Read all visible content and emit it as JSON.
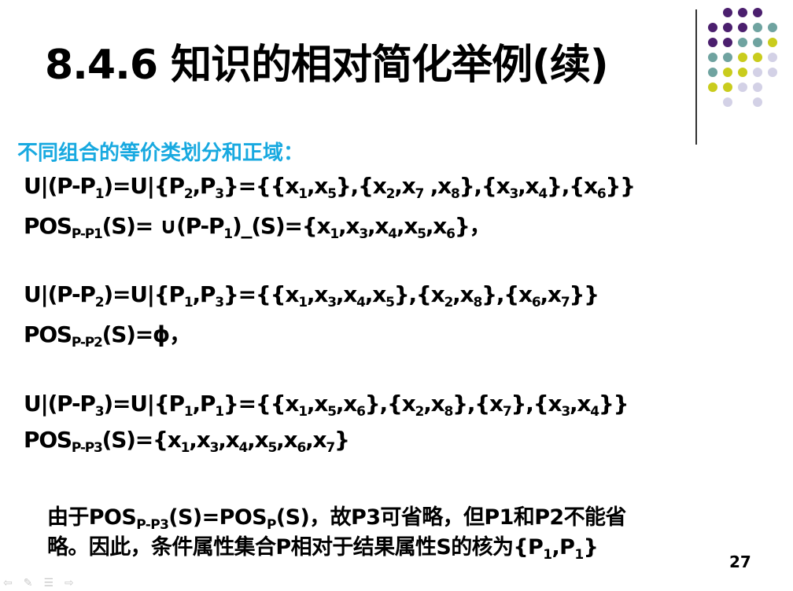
{
  "title": "8.4.6 知识的相对简化举例(续)",
  "subtitle": "不同组合的等价类划分和正域：",
  "equations": {
    "u1": [
      "U|(P-P",
      "1",
      ")=U|{P",
      "2",
      ",P",
      "3",
      "}={{x",
      "1",
      ",x",
      "5",
      "},{x",
      "2",
      ",x",
      "7",
      " ,x",
      "8",
      "},{x",
      "3",
      ",x",
      "4",
      "},{x",
      "6",
      "}}"
    ],
    "pos1": [
      "POS",
      "P-P1",
      "(S)= ∪(P-P",
      "1",
      ")_(S)={x",
      "1",
      ",x",
      "3",
      ",x",
      "4",
      ",x",
      "5",
      ",x",
      "6",
      "}，"
    ],
    "u2": [
      "U|(P-P",
      "2",
      ")=U|{P",
      "1",
      ",P",
      "3",
      "}={{x",
      "1",
      ",x",
      "3",
      ",x",
      "4",
      ",x",
      "5",
      "},{x",
      "2",
      ",x",
      "8",
      "},{x",
      "6",
      ",x",
      "7",
      "}}"
    ],
    "pos2": [
      "POS",
      "P-P2",
      "(S)=ϕ，"
    ],
    "u3": [
      "U|(P-P",
      "3",
      ")=U|{P",
      "1",
      ",P",
      "1",
      "}={{x",
      "1",
      ",x",
      "5",
      ",x",
      "6",
      "},{x",
      "2",
      ",x",
      "8",
      "},{x",
      "7",
      "},{x",
      "3",
      ",x",
      "4",
      "}}"
    ],
    "pos3": [
      "POS",
      "P-P3",
      "(S)={x",
      "1",
      ",x",
      "3",
      ",x",
      "4",
      ",x",
      "5",
      ",x",
      "6",
      ",x",
      "7",
      "}"
    ]
  },
  "conclusion": {
    "line1": [
      "由于POS",
      "P-P3",
      "(S)=POS",
      "P",
      "(S)，故P3可省略，但P1和P2不能省"
    ],
    "line2": [
      "略。因此，条件属性集合P相对于结果属性S的核为{P",
      "1",
      ",P",
      "1",
      "}"
    ]
  },
  "page_number": "27",
  "nav_icons": [
    "prev-arrow-icon",
    "pen-icon",
    "menu-icon",
    "next-arrow-icon"
  ],
  "nav_glyphs": [
    "⇦",
    "✎",
    "☰",
    "⇨"
  ],
  "colors": {
    "subtitle": "#18a9e0",
    "dot_purple": "#4b1f6e",
    "dot_teal": "#6fa3a0",
    "dot_yellow": "#c9cc1d",
    "dot_lavender": "#d3d1e6"
  },
  "dot_grid": [
    [
      null,
      "dot_purple",
      "dot_purple",
      "dot_purple",
      null
    ],
    [
      "dot_purple",
      "dot_purple",
      "dot_purple",
      "dot_teal",
      "dot_teal"
    ],
    [
      "dot_purple",
      "dot_purple",
      "dot_teal",
      "dot_teal",
      "dot_yellow"
    ],
    [
      "dot_teal",
      "dot_teal",
      "dot_yellow",
      "dot_yellow",
      "dot_lavender"
    ],
    [
      "dot_teal",
      "dot_yellow",
      "dot_yellow",
      "dot_lavender",
      "dot_lavender"
    ],
    [
      "dot_yellow",
      "dot_yellow",
      "dot_lavender",
      "dot_lavender",
      null
    ],
    [
      null,
      "dot_lavender",
      null,
      "dot_lavender",
      null
    ]
  ]
}
